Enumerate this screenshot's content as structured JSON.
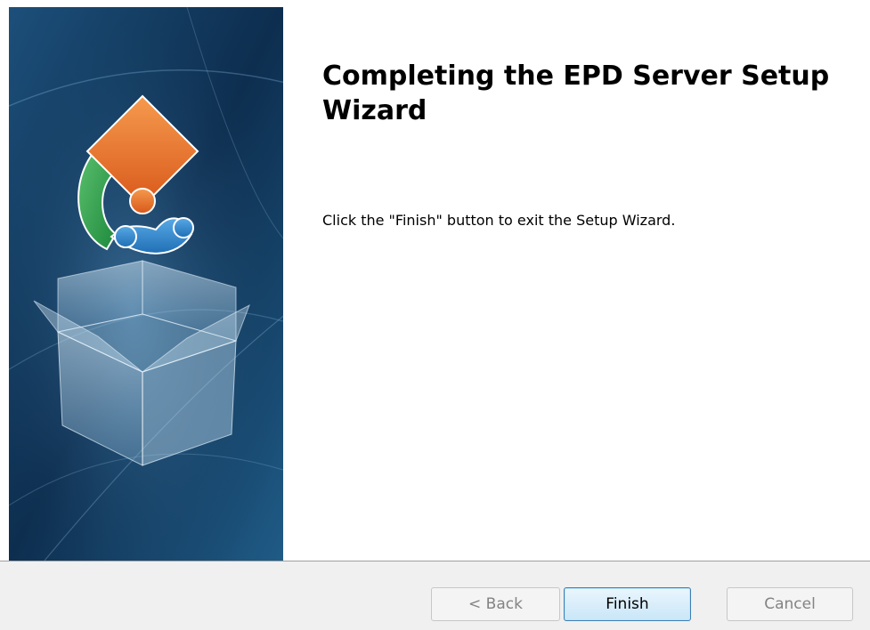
{
  "wizard": {
    "title": "Completing the EPD Server Setup Wizard",
    "message": "Click the \"Finish\" button to exit the Setup Wizard."
  },
  "buttons": {
    "back_label": "< Back",
    "back_enabled": false,
    "finish_label": "Finish",
    "cancel_label": "Cancel",
    "cancel_enabled": false
  },
  "colors": {
    "banner_dark": "#0d2e4f",
    "banner_light": "#2a6c9a",
    "puzzle_orange": "#e8722a",
    "puzzle_green": "#3aa35a",
    "puzzle_blue": "#2e8ad1",
    "footer_background": "#f0f0f0"
  },
  "icons": {
    "banner_graphic": "puzzle-box-installer-icon"
  }
}
